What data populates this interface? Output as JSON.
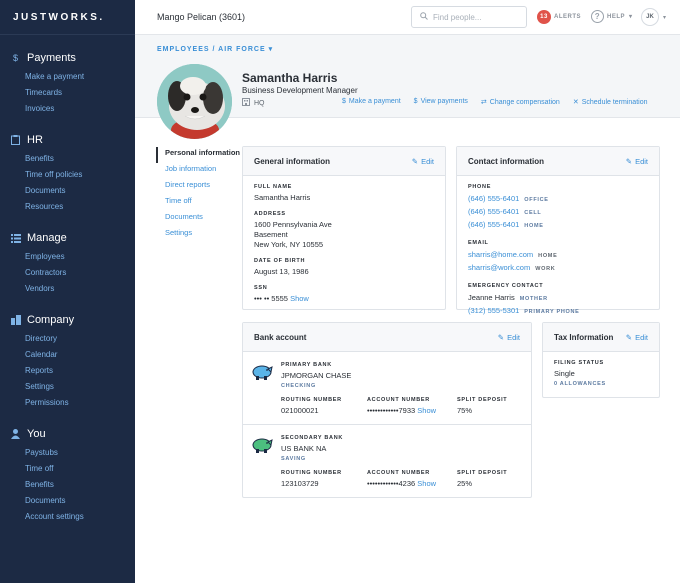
{
  "brand": "JUSTWORKS.",
  "sidebar": {
    "sections": [
      {
        "title": "Payments",
        "icon": "dollar-icon",
        "items": [
          "Make a payment",
          "Timecards",
          "Invoices"
        ]
      },
      {
        "title": "HR",
        "icon": "clipboard-icon",
        "items": [
          "Benefits",
          "Time off policies",
          "Documents",
          "Resources"
        ]
      },
      {
        "title": "Manage",
        "icon": "list-icon",
        "items": [
          "Employees",
          "Contractors",
          "Vendors"
        ]
      },
      {
        "title": "Company",
        "icon": "buildings-icon",
        "items": [
          "Directory",
          "Calendar",
          "Reports",
          "Settings",
          "Permissions"
        ]
      },
      {
        "title": "You",
        "icon": "person-icon",
        "items": [
          "Paystubs",
          "Time off",
          "Benefits",
          "Documents",
          "Account settings"
        ]
      }
    ]
  },
  "topbar": {
    "company": "Mango Pelican (3601)",
    "search_placeholder": "Find people...",
    "alerts_count": "13",
    "alerts_label": "ALERTS",
    "help_label": "HELP",
    "user_initials": "JK"
  },
  "breadcrumb": "EMPLOYEES / AIR FORCE",
  "employee": {
    "name": "Samantha Harris",
    "title": "Business Development Manager",
    "location": "HQ"
  },
  "actions": [
    "Make a payment",
    "View payments",
    "Change compensation",
    "Schedule termination"
  ],
  "subnav": [
    "Personal information",
    "Job information",
    "Direct reports",
    "Time off",
    "Documents",
    "Settings"
  ],
  "general": {
    "title": "General information",
    "edit": "Edit",
    "full_name_label": "FULL NAME",
    "full_name": "Samantha Harris",
    "address_label": "ADDRESS",
    "address_line1": "1600 Pennsylvania Ave",
    "address_line2": "Basement",
    "address_line3": "New York, NY 10555",
    "dob_label": "DATE OF BIRTH",
    "dob": "August 13, 1986",
    "ssn_label": "SSN",
    "ssn": "••• •• 5555",
    "ssn_show": "Show"
  },
  "contact": {
    "title": "Contact information",
    "edit": "Edit",
    "phone_label": "PHONE",
    "phones": [
      {
        "number": "(646) 555-6401",
        "type": "OFFICE"
      },
      {
        "number": "(646) 555-6401",
        "type": "CELL"
      },
      {
        "number": "(646) 555-6401",
        "type": "HOME"
      }
    ],
    "email_label": "EMAIL",
    "emails": [
      {
        "address": "sharris@home.com",
        "type": "HOME"
      },
      {
        "address": "sharris@work.com",
        "type": "WORK"
      }
    ],
    "emergency_label": "EMERGENCY CONTACT",
    "emergency_name": "Jeanne Harris",
    "emergency_relation": "MOTHER",
    "emergency_phone": "(312) 555-5301",
    "emergency_phone_type": "PRIMARY PHONE"
  },
  "bank": {
    "title": "Bank account",
    "edit": "Edit",
    "accounts": [
      {
        "label": "PRIMARY BANK",
        "name": "JPMORGAN CHASE",
        "type": "CHECKING",
        "routing_label": "ROUTING NUMBER",
        "routing": "021000021",
        "account_label": "ACCOUNT NUMBER",
        "account": "••••••••••••7933",
        "show": "Show",
        "split_label": "SPLIT DEPOSIT",
        "split": "75%",
        "logo_color": "#3a8fd6"
      },
      {
        "label": "SECONDARY BANK",
        "name": "US BANK NA",
        "type": "SAVING",
        "routing_label": "ROUTING NUMBER",
        "routing": "123103729",
        "account_label": "ACCOUNT NUMBER",
        "account": "••••••••••••4236",
        "show": "Show",
        "split_label": "SPLIT DEPOSIT",
        "split": "25%",
        "logo_color": "#3aa86b"
      }
    ]
  },
  "tax": {
    "title": "Tax Information",
    "edit": "Edit",
    "filing_label": "FILING STATUS",
    "filing": "Single",
    "allowances": "0 ALLOWANCES"
  }
}
